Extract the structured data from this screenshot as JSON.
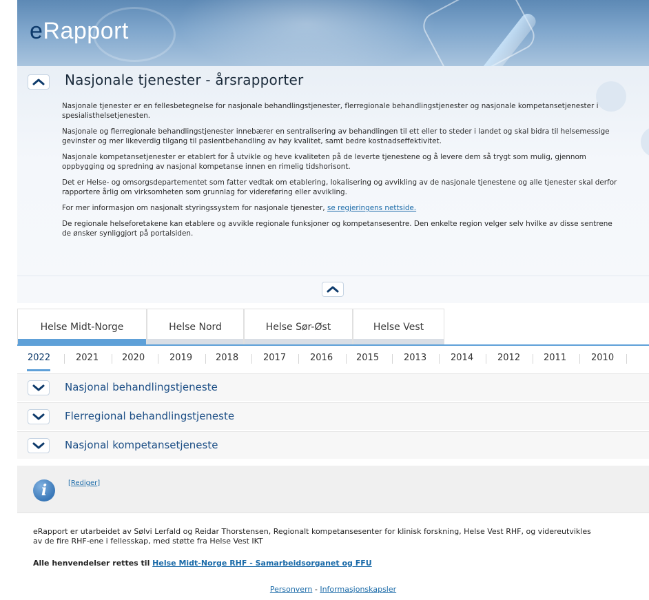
{
  "header": {
    "logo_e": "e",
    "logo_rest": "Rapport"
  },
  "intro": {
    "title": "Nasjonale tjenester - årsrapporter",
    "paragraphs": [
      "Nasjonale tjenester er en fellesbetegnelse for nasjonale behandlingstjenester, flerregionale behandlingstjenester og nasjonale kompetansetjenester i spesialisthelsetjenesten.",
      "Nasjonale og flerregionale behandlingstjenester innebærer en sentralisering av behandlingen til ett eller to steder i landet og skal bidra til helsemessige gevinster og mer likeverdig tilgang til pasientbehandling av høy kvalitet, samt bedre kostnadseffektivitet.",
      "Nasjonale kompetansetjenester er etablert for å utvikle og heve kvaliteten på de leverte tjenestene og å levere dem så trygt som mulig, gjennom oppbygging og spredning av nasjonal kompetanse innen en rimelig tidshorisont.",
      "Det er Helse- og omsorgsdepartementet som fatter vedtak om etablering, lokalisering og avvikling av de nasjonale tjenestene og alle tjenester skal derfor rapportere årlig om virksomheten som grunnlag for videreføring eller avvikling.",
      "For mer informasjon om nasjonalt styringssystem for nasjonale tjenester, ",
      "De regionale helseforetakene kan etablere og avvikle regionale funksjoner og kompetansesentre. Den enkelte region velger selv hvilke av disse sentrene de ønsker synliggjort på portalsiden."
    ],
    "link_text": "se regjeringens nettside."
  },
  "tabs": [
    {
      "label": "Helse Midt-Norge"
    },
    {
      "label": "Helse Nord"
    },
    {
      "label": "Helse Sør-Øst"
    },
    {
      "label": "Helse Vest"
    }
  ],
  "years": [
    "2022",
    "2021",
    "2020",
    "2019",
    "2018",
    "2017",
    "2016",
    "2015",
    "2013",
    "2014",
    "2012",
    "2011",
    "2010"
  ],
  "accordion": [
    {
      "label": "Nasjonal behandlingstjeneste"
    },
    {
      "label": "Flerregional behandlingstjeneste"
    },
    {
      "label": "Nasjonal kompetansetjeneste"
    }
  ],
  "info": {
    "icon_letter": "i",
    "edit_label": "Rediger"
  },
  "footer": {
    "credit": "eRapport er utarbeidet av Sølvi Lerfald og Reidar Thorstensen, Regionalt kompetansesenter for klinisk forskning, Helse Vest RHF, og videreutvikles av de fire RHF-ene i fellesskap, med støtte fra Helse Vest IKT",
    "contact_prefix": "Alle henvendelser rettes til ",
    "contact_link": "Helse Midt-Norge RHF - Samarbeidsorganet og FFU",
    "privacy": "Personvern",
    "separator": " - ",
    "cookies": "Informasjonskapsler"
  },
  "colors": {
    "accent": "#5ea0d8",
    "link": "#1a6aa8",
    "heading": "#1d4f86"
  }
}
